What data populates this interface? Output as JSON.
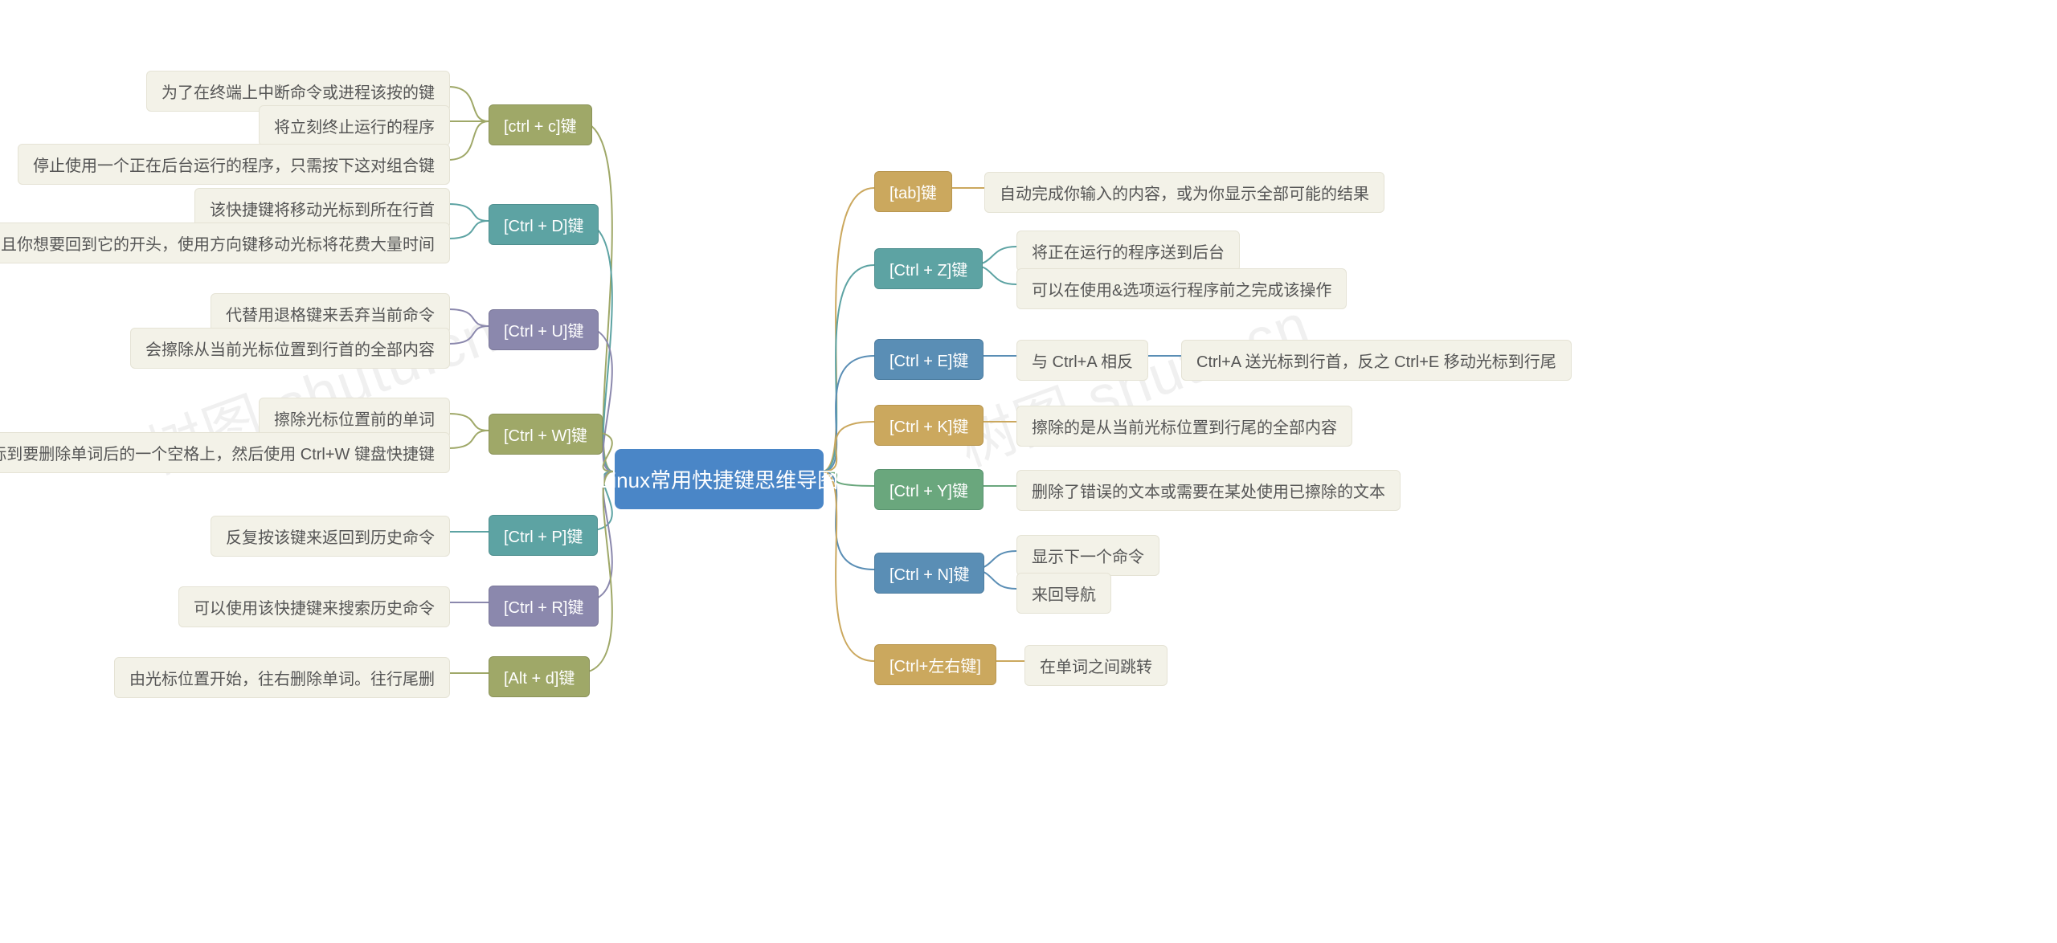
{
  "watermark": "树图 shutu.cn",
  "center": {
    "label": "Linux常用快捷键思维导图"
  },
  "left": [
    {
      "key": "ctrl_c",
      "label": "[ctrl + c]键",
      "color": "olive",
      "children": [
        {
          "label": "为了在终端上中断命令或进程该按的键"
        },
        {
          "label": "将立刻终止运行的程序"
        },
        {
          "label": "停止使用一个正在后台运行的程序，只需按下这对组合键"
        }
      ]
    },
    {
      "key": "ctrl_d",
      "label": "[Ctrl + D]键",
      "color": "teal",
      "children": [
        {
          "label": "该快捷键将移动光标到所在行首"
        },
        {
          "label": "在终端输入了一个很长的命令或路径，并且你想要回到它的开头，使用方向键移动光标将花费大量时间"
        }
      ]
    },
    {
      "key": "ctrl_u",
      "label": "[Ctrl + U]键",
      "color": "purple",
      "children": [
        {
          "label": "代替用退格键来丢弃当前命令"
        },
        {
          "label": "会擦除从当前光标位置到行首的全部内容"
        }
      ]
    },
    {
      "key": "ctrl_w",
      "label": "[Ctrl + W]键",
      "color": "olive",
      "children": [
        {
          "label": "擦除光标位置前的单词"
        },
        {
          "label": "用它移动光标到要删除单词后的一个空格上，然后使用 Ctrl+W 键盘快捷键"
        }
      ]
    },
    {
      "key": "ctrl_p",
      "label": "[Ctrl + P]键",
      "color": "teal",
      "children": [
        {
          "label": "反复按该键来返回到历史命令"
        }
      ]
    },
    {
      "key": "ctrl_r",
      "label": "[Ctrl + R]键",
      "color": "purple",
      "children": [
        {
          "label": "可以使用该快捷键来搜索历史命令"
        }
      ]
    },
    {
      "key": "alt_d",
      "label": "[Alt + d]键",
      "color": "olive",
      "children": [
        {
          "label": "由光标位置开始，往右删除单词。往行尾删"
        }
      ]
    }
  ],
  "right": [
    {
      "key": "tab",
      "label": "[tab]键",
      "color": "gold",
      "children": [
        {
          "label": "自动完成你输入的内容，或为你显示全部可能的结果"
        }
      ]
    },
    {
      "key": "ctrl_z",
      "label": "[Ctrl + Z]键",
      "color": "teal",
      "children": [
        {
          "label": "将正在运行的程序送到后台"
        },
        {
          "label": "可以在使用&选项运行程序前之完成该操作"
        }
      ]
    },
    {
      "key": "ctrl_e",
      "label": "[Ctrl + E]键",
      "color": "steelblue",
      "children": [
        {
          "label": "与 Ctrl+A 相反",
          "children": [
            {
              "label": "Ctrl+A 送光标到行首，反之 Ctrl+E 移动光标到行尾"
            }
          ]
        }
      ]
    },
    {
      "key": "ctrl_k",
      "label": "[Ctrl + K]键",
      "color": "gold",
      "children": [
        {
          "label": "擦除的是从当前光标位置到行尾的全部内容"
        }
      ]
    },
    {
      "key": "ctrl_y",
      "label": "[Ctrl + Y]键",
      "color": "green",
      "children": [
        {
          "label": "删除了错误的文本或需要在某处使用已擦除的文本"
        }
      ]
    },
    {
      "key": "ctrl_n",
      "label": "[Ctrl + N]键",
      "color": "steelblue",
      "children": [
        {
          "label": "显示下一个命令"
        },
        {
          "label": "来回导航"
        }
      ]
    },
    {
      "key": "ctrl_lr",
      "label": "[Ctrl+左右键]",
      "color": "gold",
      "children": [
        {
          "label": "在单词之间跳转"
        }
      ]
    }
  ]
}
